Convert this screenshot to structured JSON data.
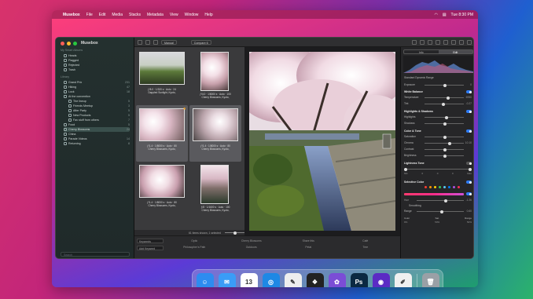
{
  "menubar": {
    "app_name": "Musebox",
    "menus": [
      "File",
      "Edit",
      "Media",
      "Stacks",
      "Metadata",
      "View",
      "Window",
      "Help"
    ],
    "clock": "Tue 8:30 PM"
  },
  "window": {
    "title": "Musebox"
  },
  "sidebar": {
    "sections": [
      {
        "label": "My Smart Albums"
      },
      {
        "label": "Library"
      }
    ],
    "smart_albums": [
      {
        "label": "Heads"
      },
      {
        "label": "Flagged"
      },
      {
        "label": "Rejected"
      },
      {
        "label": "Trash"
      }
    ],
    "library": [
      {
        "label": "Grand Prix",
        "count": "231"
      },
      {
        "label": "Hiking",
        "count": "47"
      },
      {
        "label": "Lock",
        "count": "18"
      },
      {
        "label": "At the convention",
        "count": ""
      },
      {
        "label": "The lineup",
        "count": "5"
      },
      {
        "label": "Friends Meetup",
        "count": "3"
      },
      {
        "label": "After Party",
        "count": "5"
      },
      {
        "label": "New Products",
        "count": "5"
      },
      {
        "label": "Fav stuff from others",
        "count": "7"
      },
      {
        "label": "Food",
        "count": "5"
      },
      {
        "label": "Cherry Blossoms",
        "count": "24"
      },
      {
        "label": "China",
        "count": ""
      },
      {
        "label": "Parade Videos",
        "count": "14"
      },
      {
        "label": "Returning",
        "count": "8"
      }
    ],
    "search_placeholder": "Search"
  },
  "toolbar": {
    "sort_label": "Manual",
    "compare_label": "Compare 6"
  },
  "thumbnails": [
    {
      "caption1": "ƒ/8.0 · 1/320 s · Auto · 24",
      "caption2": "Dappled Sunlight, Kyoto,"
    },
    {
      "caption1": "ƒ/4.0 · 1/8000 s · Auto · 100",
      "caption2": "Cherry Blossoms, Kyoto,"
    },
    {
      "caption1": "ƒ/1.4 · 1/8000 s · Auto · 80",
      "caption2": "Cherry Blossoms, Kyoto,"
    },
    {
      "caption1": "ƒ/1.4 · 1/8000 s · Auto · 80",
      "caption2": "Cherry Blossoms, Kyoto,"
    },
    {
      "caption1": "ƒ/1.4 · 1/8000 s · Auto · 80",
      "caption2": "Cherry Blossoms, Kyoto,"
    },
    {
      "caption1": "ƒ/8 · 1/1600 s · Auto · 100",
      "caption2": "Cherry Blossoms, Kyoto,"
    }
  ],
  "browser_status": "61 items shown, 1 selected",
  "metadata": {
    "keyword_field": "Keywords",
    "name_field": "Add Keyword",
    "row1": [
      "Optic",
      "Cherry Blossoms",
      "Share this",
      "Café"
    ],
    "row2": [
      "Philosopher's Path",
      "Outdoors",
      "Petal",
      "Tree"
    ]
  },
  "inspector": {
    "tabs": [
      "Info",
      "Edit"
    ],
    "active_tab": "Edit",
    "standard_range": "Standard Dynamic Range",
    "exposure_label": "Exposure",
    "exposure_value": "0",
    "white_balance_label": "White Balance",
    "temperature_label": "Temperature",
    "temperature_value": "6950",
    "tint_label": "Tint",
    "tint_value": "-0.27",
    "highlights_head": "Highlights & Shadows",
    "highlights_label": "Highlights",
    "shadows_label": "Shadows",
    "color_tone_head": "Color & Tone",
    "saturation_label": "Saturation",
    "chroma_label": "Chroma",
    "chroma_value": "10.10",
    "contrast_label": "Contrast",
    "brightness_label": "Brightness",
    "lightness_head": "Lightness Tone",
    "lightness_cols": [
      "Min",
      "0",
      "0",
      "0",
      "Max"
    ],
    "selective_head": "Selective Color",
    "hue_label": "Hue",
    "hue_value": "-1.26",
    "smoothing_label": "Smoothing",
    "range_label": "Range",
    "range_value": "0.60",
    "bottom_labels": [
      "Color",
      "Sat.",
      "Range"
    ],
    "bottom_values": [
      "0%",
      "50%",
      "50%"
    ],
    "colors": {
      "accent": "#2f7bf5",
      "swatches": [
        "#ff3b30",
        "#ff9500",
        "#ffcc00",
        "#34c759",
        "#5ac8fa",
        "#007aff",
        "#af52de",
        "#ff2d55"
      ]
    }
  },
  "dock": {
    "apps": [
      {
        "icon": "finder-icon",
        "color": "#2d8cf0",
        "glyph": "☺"
      },
      {
        "icon": "mail-icon",
        "color": "#3a9cf7",
        "glyph": "✉"
      },
      {
        "icon": "calendar-icon",
        "color": "#ffffff",
        "glyph": "13"
      },
      {
        "icon": "safari-icon",
        "color": "#1e88e5",
        "glyph": "◎"
      },
      {
        "icon": "script-editor-icon",
        "color": "#eeeeee",
        "glyph": "✎"
      },
      {
        "icon": "figma-icon",
        "color": "#222222",
        "glyph": "❖"
      },
      {
        "icon": "musebox-icon",
        "color": "#7b4dd6",
        "glyph": "✿"
      },
      {
        "icon": "photoshop-icon",
        "color": "#0b2942",
        "glyph": "Ps"
      },
      {
        "icon": "nova-icon",
        "color": "#5b2bc4",
        "glyph": "◉"
      },
      {
        "icon": "pencil-icon",
        "color": "#f0f0f0",
        "glyph": "✐"
      },
      {
        "icon": "trash-icon",
        "color": "#9aa0a6",
        "glyph": "🗑"
      }
    ],
    "calendar_month": "JUN"
  }
}
